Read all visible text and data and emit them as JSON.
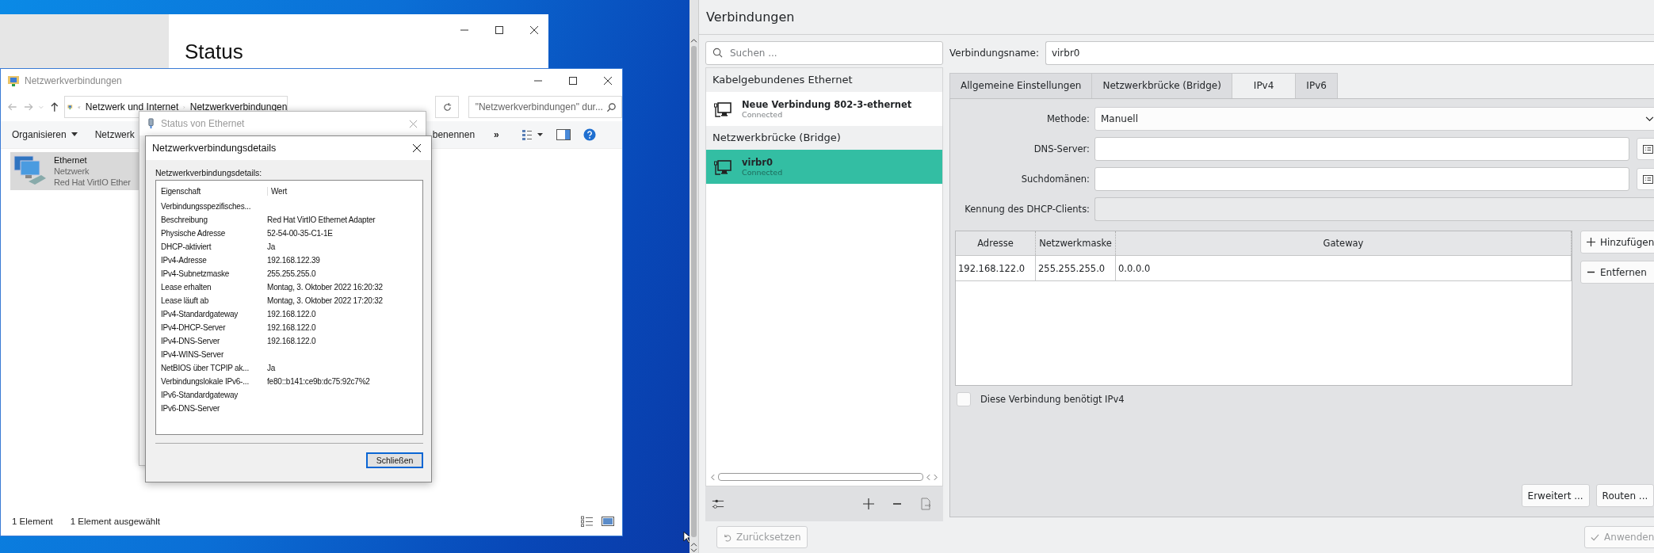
{
  "desktop": {
    "settings_window": {
      "heading": "Status"
    },
    "explorer": {
      "title": "Netzwerkverbindungen",
      "breadcrumb": [
        "Netzwerk und Internet",
        "Netzwerkverbindungen"
      ],
      "search": {
        "placeholder": "\"Netzwerkverbindungen\" dur..."
      },
      "toolbar": [
        {
          "kind": "menu",
          "label": "Organisieren"
        },
        {
          "kind": "plain",
          "label": "Netzwerk"
        },
        {
          "kind": "plain",
          "label": "benennen"
        },
        {
          "kind": "more",
          "label": "»"
        }
      ],
      "items": [
        {
          "name": "Ethernet",
          "type": "Netzwerk",
          "adapter": "Red Hat VirtIO Ether",
          "selected": true
        }
      ],
      "status_bar": [
        "1 Element",
        "1 Element ausgewählt"
      ]
    },
    "status_dialog": {
      "title": "Status von Ethernet"
    },
    "details_dialog": {
      "title": "Netzwerkverbindungsdetails",
      "label": "Netzwerkverbindungsdetails:",
      "columns": [
        "Eigenschaft",
        "Wert"
      ],
      "rows": [
        {
          "property": "Verbindungsspezifisches..."
        },
        {
          "property": "Beschreibung",
          "value": "Red Hat VirtIO Ethernet Adapter"
        },
        {
          "property": "Physische Adresse",
          "value": "52-54-00-35-C1-1E"
        },
        {
          "property": "DHCP-aktiviert",
          "value": "Ja"
        },
        {
          "property": "IPv4-Adresse",
          "value": "192.168.122.39"
        },
        {
          "property": "IPv4-Subnetzmaske",
          "value": "255.255.255.0"
        },
        {
          "property": "Lease erhalten",
          "value": "Montag, 3. Oktober 2022 16:20:32"
        },
        {
          "property": "Lease läuft ab",
          "value": "Montag, 3. Oktober 2022 17:20:32"
        },
        {
          "property": "IPv4-Standardgateway",
          "value": "192.168.122.0"
        },
        {
          "property": "IPv4-DHCP-Server",
          "value": "192.168.122.0"
        },
        {
          "property": "IPv4-DNS-Server",
          "value": "192.168.122.0"
        },
        {
          "property": "IPv4-WINS-Server"
        },
        {
          "property": "NetBIOS über TCPIP ak...",
          "value": "Ja"
        },
        {
          "property": "Verbindungslokale IPv6-...",
          "value": "fe80::b141:ce9b:dc75:92c7%2"
        },
        {
          "property": "IPv6-Standardgateway"
        },
        {
          "property": "IPv6-DNS-Server"
        }
      ],
      "button": "Schließen"
    }
  },
  "kde": {
    "title": "Verbindungen",
    "search": {
      "placeholder": "Suchen ..."
    },
    "groups": [
      {
        "name": "Kabelgebundenes Ethernet",
        "connections": [
          {
            "name": "Neue Verbindung 802-3-ethernet",
            "status": "Connected",
            "selected": false
          }
        ]
      },
      {
        "name": "Netzwerkbrücke (Bridge)",
        "connections": [
          {
            "name": "virbr0",
            "status": "Connected",
            "selected": true
          }
        ]
      }
    ],
    "connection_name": {
      "label": "Verbindungsname:",
      "value": "virbr0"
    },
    "tabs": [
      {
        "label": "Allgemeine Einstellungen",
        "selected": false
      },
      {
        "label": "Netzwerkbrücke (Bridge)",
        "selected": false
      },
      {
        "label": "IPv4",
        "selected": true
      },
      {
        "label": "IPv6",
        "selected": false
      }
    ],
    "form": [
      {
        "kind": "select",
        "label": "Methode:",
        "value": "Manuell",
        "disabled": false
      },
      {
        "kind": "list",
        "label": "DNS-Server:",
        "disabled": false
      },
      {
        "kind": "list",
        "label": "Suchdomänen:",
        "disabled": false
      },
      {
        "kind": "text",
        "label": "Kennung des DHCP-Clients:",
        "disabled": true
      }
    ],
    "table": {
      "columns": [
        "Adresse",
        "Netzwerkmaske",
        "Gateway"
      ],
      "rows": [
        [
          "192.168.122.0",
          "255.255.255.0",
          "0.0.0.0"
        ]
      ]
    },
    "table_buttons": [
      {
        "kind": "add",
        "label": "Hinzufügen"
      },
      {
        "kind": "remove",
        "label": "Entfernen"
      }
    ],
    "checkbox": {
      "label": "Diese Verbindung benötigt IPv4",
      "checked": false
    },
    "panel_buttons": [
      "Erweitert ...",
      "Routen ..."
    ],
    "footer": [
      {
        "kind": "reset",
        "label": "Zurücksetzen",
        "disabled": true
      },
      {
        "kind": "apply",
        "label": "Anwenden",
        "disabled": true
      }
    ]
  }
}
